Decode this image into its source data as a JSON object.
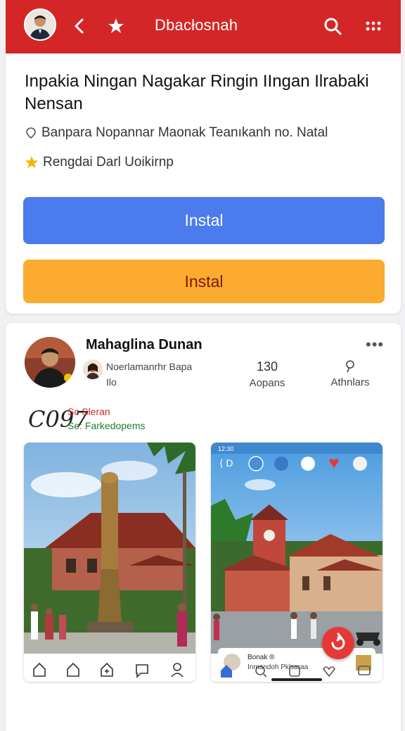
{
  "topbar": {
    "title": "Dbacłosnah",
    "icons": [
      "back-chevron-icon",
      "star-icon",
      "search-icon",
      "more-dots-icon"
    ],
    "color": "#d42626"
  },
  "article": {
    "headline": "Inpakia Ningan Nagakar Ringin IIngan Ilrabaki Nensan",
    "location": "Banpara Nopannar Maonak Teanıkanh no. Natal",
    "rating": "Rengdai Darl Uoikirnp",
    "button_primary": "Instal",
    "button_secondary": "Instal"
  },
  "post": {
    "author": "Mahaglina Dunan",
    "more": "•••",
    "subline1": "Noerlamanrhr Bapa",
    "subline2": "Ilo",
    "stats": [
      {
        "value": "130",
        "label": "Aopans"
      },
      {
        "value": "",
        "label": "Athnlars"
      }
    ],
    "code": "C097",
    "tag1": "Sc Sleran",
    "tag2": "Se: Farkedopems",
    "photo2_status": "12:30",
    "photo2_card_title": "Bonak ®",
    "photo2_card_sub": "Inmandoh Pklsaraa"
  },
  "colors": {
    "accent_red": "#d42626",
    "button_blue": "#4b7bec",
    "button_orange": "#fbab2f"
  }
}
